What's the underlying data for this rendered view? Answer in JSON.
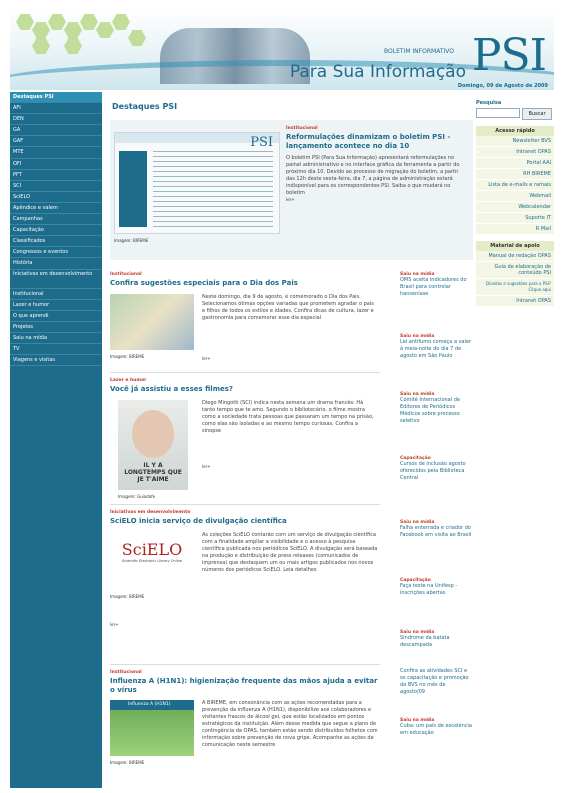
{
  "header": {
    "brand_small": "BOLETIM INFORMATIVO",
    "brand_name": "PSI",
    "brand_subtitle": "Para Sua Informação",
    "date": "Domingo, 09 de Agosto de 2009"
  },
  "left_nav": {
    "items": [
      "Destaques PSI",
      "AFI",
      "DEN",
      "GA",
      "GAF",
      "MTE",
      "OFI",
      "PFT",
      "SCI",
      "SciELO",
      "Apêndice e valem",
      "Campanhas",
      "Capacitação",
      "Classificados",
      "Congressos e eventos",
      "História",
      "Iniciativas em desenvolvimento",
      "Institucional",
      "Lazer e humor",
      "O que aprendi",
      "Projetos",
      "Saiu na mídia",
      "TV",
      "Viagens e visitas"
    ]
  },
  "main": {
    "heading": "Destaques PSI",
    "feature": {
      "kicker": "Institucional",
      "title": "Reformulações dinamizam o boletim PSI - lançamento acontece no dia 10",
      "body": "O boletim PSI (Para Sua Informação) apresentará reformulações no painel administrativo e no interface gráfica da ferramenta a partir do próximo dia 10. Devido ao processo de migração do boletim, a partir das 12h deste sexta-feira, dia 7, a página de administração estará indisponível para os correspondentes PSI. Saiba o que mudará no boletim",
      "caption": "Imagem: BIREME",
      "more": "ler+",
      "thumb_psi": "PSI"
    },
    "stories": [
      {
        "kicker": "Institucional",
        "title": "Confira sugestões especiais para o Dia dos Pais",
        "body": "Neste domingo, dia 9 de agosto, é comemorado o Dia dos Pais. Selecionamos ótimas opções variadas que prometem agradar o pais e filhos de todos os estilos e idades. Confira dicas de cultura, lazer e gastronomia para comemorar esse dia especial",
        "caption": "Imagem: BIREME",
        "more": "ler+"
      },
      {
        "kicker": "Lazer e humor",
        "title": "Você já assistiu a esses filmes?",
        "body": "Diego Mingotti (SCI) indica nesta semana um drama francês: Há tanto tempo que te amo. Segundo o bibliotecário, o filme mostra como a sociedade trata pessoas que passaram um tempo na prisão, como elas são isoladas e ao mesmo tempo curiosas. Confira a sinopse",
        "caption": "Imagem: Guiadafe",
        "more": "ler+",
        "poster_text": "IL Y A LONGTEMPS QUE JE T'AIME"
      },
      {
        "kicker": "Iniciativas em desenvolvimento",
        "title": "SciELO inicia serviço de divulgação científica",
        "body": "As coleções SciELO contarão com um serviço de divulgação científica com a finalidade ampliar a visibilidade e o acesso à pesquisa científica publicada nos periódicos SciELO. A divulgação será baseada na produção e distribuição de press releases (comunicados de imprensa) que destaquem um ou mais artigos publicados nos novos números dos periódicos SciELO. Leia detalhes",
        "caption": "Imagem: BIREME",
        "more": "ler+",
        "logo_text": "SciELO",
        "logo_sub": "Scientific Electronic Library Online"
      },
      {
        "kicker": "Institucional",
        "title": "Influenza A (H1N1): higienização frequente das mãos ajuda a evitar o vírus",
        "body": "A BIREME, em consonância com as ações recomendadas para a prevenção da influenza A (H1N1), disponibilize aos colaboradores e visitantes frascos de álcool gel, que estão localizados em pontos estratégicos da instituição. Além desse medida que segue a plano de contingência da OPAS, também estão sendo distribuídos folhetos com informação sobre prevenção de nova gripe. Acompanhe as ações de comunicação neste semestre",
        "caption": "Imagem: BIREME",
        "thumb_label": "Influenza A (H1N1)"
      }
    ]
  },
  "mid_column": [
    {
      "kicker": "Saiu na mídia",
      "text": "OMS aceita indicadores do Brasil para controlar hanseníase",
      "more": "ler+"
    },
    {
      "kicker": "Saiu na mídia",
      "text": "Lei antifumo começa a valer à meia-noite do dia 7 de agosto em São Paulo",
      "more": "ler+"
    },
    {
      "kicker": "Saiu na mídia",
      "text": "Comitê Internacional de Editores de Periódicos Médicos sobre processo seletivo",
      "more": "ler+"
    },
    {
      "kicker": "Capacitação",
      "text": "Cursos de inclusão agosto oferecidos pela Biblioteca Central",
      "more": "ler+"
    },
    {
      "kicker": "Saiu na mídia",
      "text": "Falha enterrada e criador do Facebook em visita ao Brasil",
      "more": "ler+"
    },
    {
      "kicker": "Capacitação",
      "text": "Faça teste na Unifesp - inscrições abertas",
      "more": "ler+"
    },
    {
      "kicker": "Saiu na mídia",
      "text": "Síndrome da batata descampada",
      "more": "ler+"
    },
    {
      "kicker": "",
      "text": "Confira as atividades SCI e os capacitação e promoção da BVS no mês de agosto/09",
      "more": "ler+"
    },
    {
      "kicker": "Saiu na mídia",
      "text": "Cuba: um país de excelência em educação",
      "more": "ler+"
    }
  ],
  "right": {
    "search_label": "Pesquisa",
    "search_placeholder": "",
    "search_button": "Buscar",
    "quick_header": "Acesso rápido",
    "quick_links": [
      "Newsletter BVS",
      "Intranet OPAS",
      "Portal AAI",
      "RH BIREME",
      "Lista de e-mails e ramais",
      "Webmail",
      "Webcalendar",
      "Suporte IT",
      "R Mail"
    ],
    "support_header": "Material de apoio",
    "support_links": [
      "Manual de redação OPAS",
      "Guia de elaboração de conteúdo PSI",
      "Dúvidas e sugestões para o PSI? Clique aqui",
      "Intranet OPAS"
    ]
  },
  "colors": {
    "primary": "#1e6c8c",
    "kicker": "#c0392b",
    "accent_green": "#e4ecc7"
  }
}
